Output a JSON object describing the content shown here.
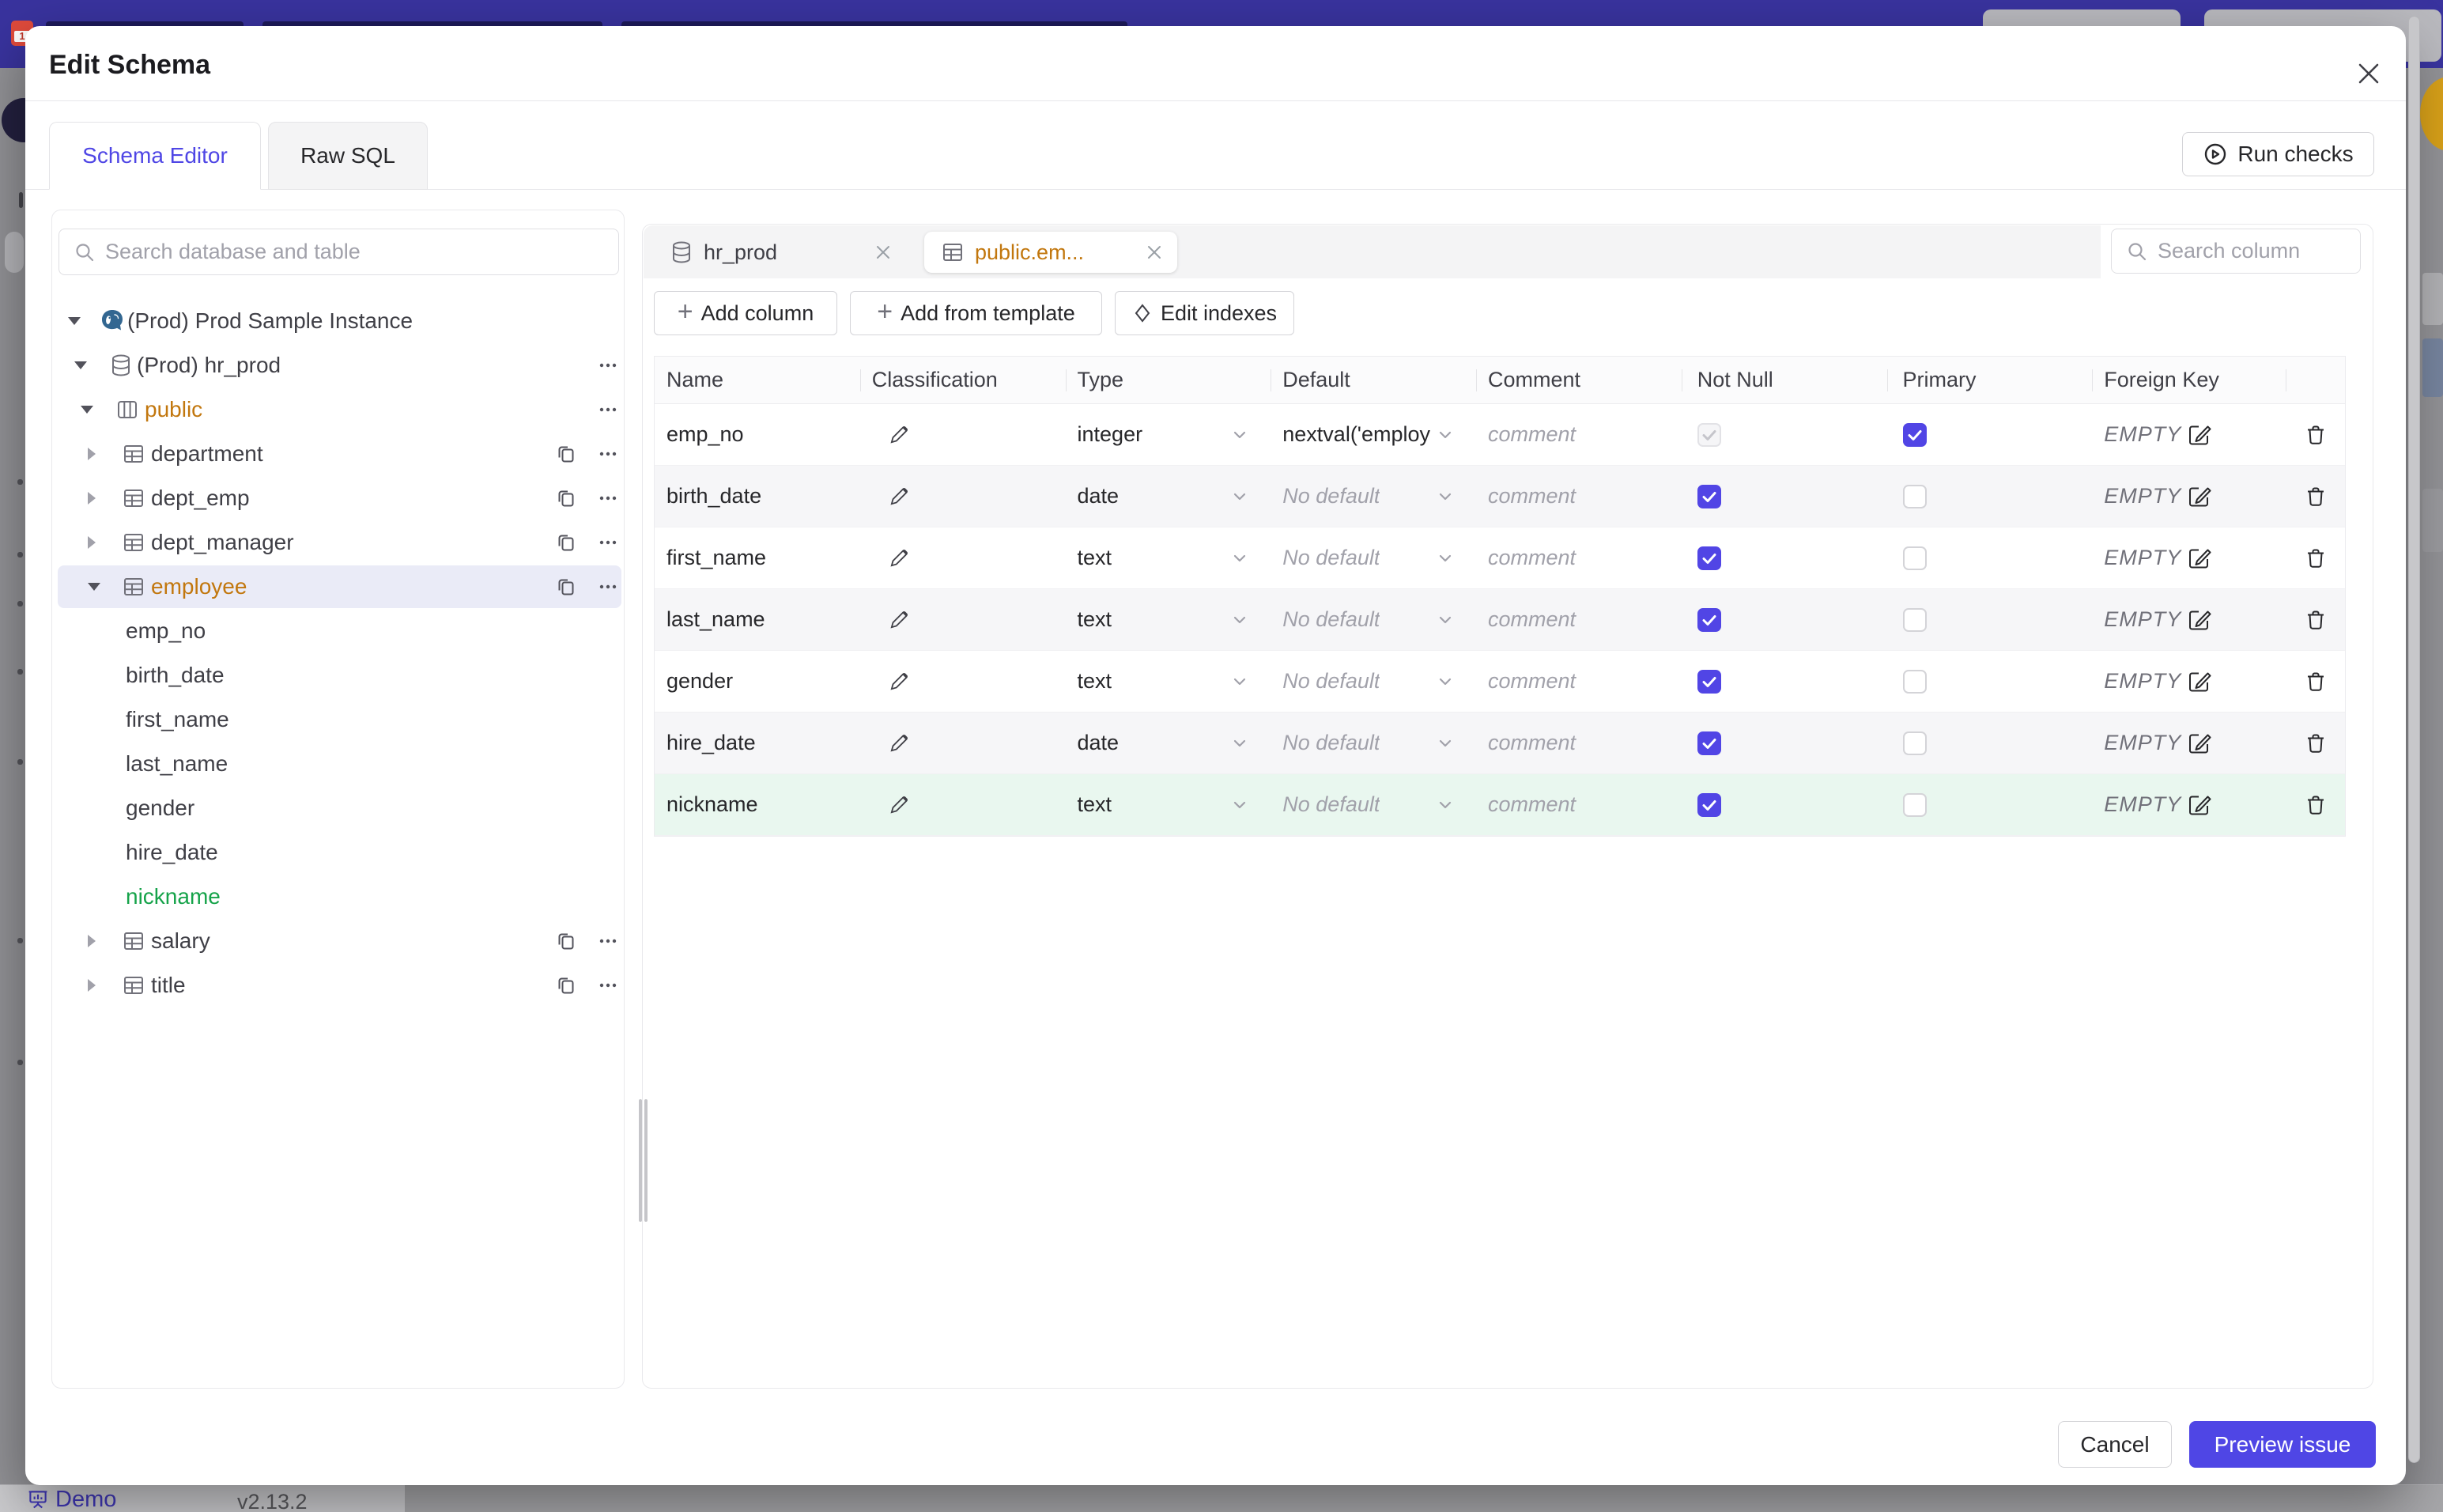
{
  "backdrop": {
    "demo_label": "Demo",
    "version": "v2.13.2"
  },
  "modal": {
    "title": "Edit Schema"
  },
  "tabs": {
    "schema_editor": "Schema Editor",
    "raw_sql": "Raw SQL"
  },
  "toolbar": {
    "run_checks": "Run checks"
  },
  "sidebar": {
    "search_placeholder": "Search database and table",
    "tree": [
      {
        "label": "(Prod) Prod Sample Instance",
        "level": 0,
        "icon": "postgres",
        "arrow": "expanded",
        "color": null,
        "copy": false,
        "menu": false,
        "selected": false
      },
      {
        "label": "(Prod) hr_prod",
        "level": 1,
        "icon": "database",
        "arrow": "expanded",
        "color": null,
        "copy": false,
        "menu": true,
        "selected": false
      },
      {
        "label": "public",
        "level": 2,
        "icon": "schema",
        "arrow": "expanded",
        "color": "amber",
        "copy": false,
        "menu": true,
        "selected": false
      },
      {
        "label": "department",
        "level": 3,
        "icon": "table",
        "arrow": "collapsed",
        "color": null,
        "copy": true,
        "menu": true,
        "selected": false
      },
      {
        "label": "dept_emp",
        "level": 3,
        "icon": "table",
        "arrow": "collapsed",
        "color": null,
        "copy": true,
        "menu": true,
        "selected": false
      },
      {
        "label": "dept_manager",
        "level": 3,
        "icon": "table",
        "arrow": "collapsed",
        "color": null,
        "copy": true,
        "menu": true,
        "selected": false
      },
      {
        "label": "employee",
        "level": 3,
        "icon": "table",
        "arrow": "expanded",
        "color": "amber",
        "copy": true,
        "menu": true,
        "selected": true
      },
      {
        "label": "emp_no",
        "level": 4,
        "icon": null,
        "arrow": null,
        "color": null,
        "copy": false,
        "menu": false,
        "selected": false
      },
      {
        "label": "birth_date",
        "level": 4,
        "icon": null,
        "arrow": null,
        "color": null,
        "copy": false,
        "menu": false,
        "selected": false
      },
      {
        "label": "first_name",
        "level": 4,
        "icon": null,
        "arrow": null,
        "color": null,
        "copy": false,
        "menu": false,
        "selected": false
      },
      {
        "label": "last_name",
        "level": 4,
        "icon": null,
        "arrow": null,
        "color": null,
        "copy": false,
        "menu": false,
        "selected": false
      },
      {
        "label": "gender",
        "level": 4,
        "icon": null,
        "arrow": null,
        "color": null,
        "copy": false,
        "menu": false,
        "selected": false
      },
      {
        "label": "hire_date",
        "level": 4,
        "icon": null,
        "arrow": null,
        "color": null,
        "copy": false,
        "menu": false,
        "selected": false
      },
      {
        "label": "nickname",
        "level": 4,
        "icon": null,
        "arrow": null,
        "color": "green",
        "copy": false,
        "menu": false,
        "selected": false
      },
      {
        "label": "salary",
        "level": 3,
        "icon": "table",
        "arrow": "collapsed",
        "color": null,
        "copy": true,
        "menu": true,
        "selected": false
      },
      {
        "label": "title",
        "level": 3,
        "icon": "table",
        "arrow": "collapsed",
        "color": null,
        "copy": true,
        "menu": true,
        "selected": false
      }
    ]
  },
  "editor": {
    "open_tabs": [
      {
        "label": "hr_prod",
        "icon": "database",
        "active": false
      },
      {
        "label": "public.em...",
        "icon": "table",
        "active": true
      }
    ],
    "search_placeholder": "Search column",
    "actions": [
      {
        "label": "Add column",
        "icon": "plus"
      },
      {
        "label": "Add from template",
        "icon": "plus"
      },
      {
        "label": "Edit indexes",
        "icon": "diamond"
      }
    ],
    "table": {
      "headers": [
        "Name",
        "Classification",
        "Type",
        "Default",
        "Comment",
        "Not Null",
        "Primary",
        "Foreign Key",
        ""
      ],
      "rows": [
        {
          "name": "emp_no",
          "type": "integer",
          "default": "nextval('employ",
          "default_is_placeholder": false,
          "comment_placeholder": "comment",
          "not_null_checked": true,
          "not_null_disabled": true,
          "primary": true,
          "foreign_key": "EMPTY",
          "highlight": null
        },
        {
          "name": "birth_date",
          "type": "date",
          "default": "No default",
          "default_is_placeholder": true,
          "comment_placeholder": "comment",
          "not_null_checked": true,
          "not_null_disabled": false,
          "primary": false,
          "foreign_key": "EMPTY",
          "highlight": null
        },
        {
          "name": "first_name",
          "type": "text",
          "default": "No default",
          "default_is_placeholder": true,
          "comment_placeholder": "comment",
          "not_null_checked": true,
          "not_null_disabled": false,
          "primary": false,
          "foreign_key": "EMPTY",
          "highlight": null
        },
        {
          "name": "last_name",
          "type": "text",
          "default": "No default",
          "default_is_placeholder": true,
          "comment_placeholder": "comment",
          "not_null_checked": true,
          "not_null_disabled": false,
          "primary": false,
          "foreign_key": "EMPTY",
          "highlight": null
        },
        {
          "name": "gender",
          "type": "text",
          "default": "No default",
          "default_is_placeholder": true,
          "comment_placeholder": "comment",
          "not_null_checked": true,
          "not_null_disabled": false,
          "primary": false,
          "foreign_key": "EMPTY",
          "highlight": null
        },
        {
          "name": "hire_date",
          "type": "date",
          "default": "No default",
          "default_is_placeholder": true,
          "comment_placeholder": "comment",
          "not_null_checked": true,
          "not_null_disabled": false,
          "primary": false,
          "foreign_key": "EMPTY",
          "highlight": null
        },
        {
          "name": "nickname",
          "type": "text",
          "default": "No default",
          "default_is_placeholder": true,
          "comment_placeholder": "comment",
          "not_null_checked": true,
          "not_null_disabled": false,
          "primary": false,
          "foreign_key": "EMPTY",
          "highlight": "green"
        }
      ]
    }
  },
  "footer": {
    "cancel": "Cancel",
    "preview_issue": "Preview issue"
  },
  "colors": {
    "accent": "#4f46e5",
    "changed_amber": "#c2770e",
    "added_green": "#16a34a",
    "header_indigo": "#39339e",
    "added_row_bg": "#e9f7ef",
    "selected_tree_bg": "#eaebf7"
  }
}
